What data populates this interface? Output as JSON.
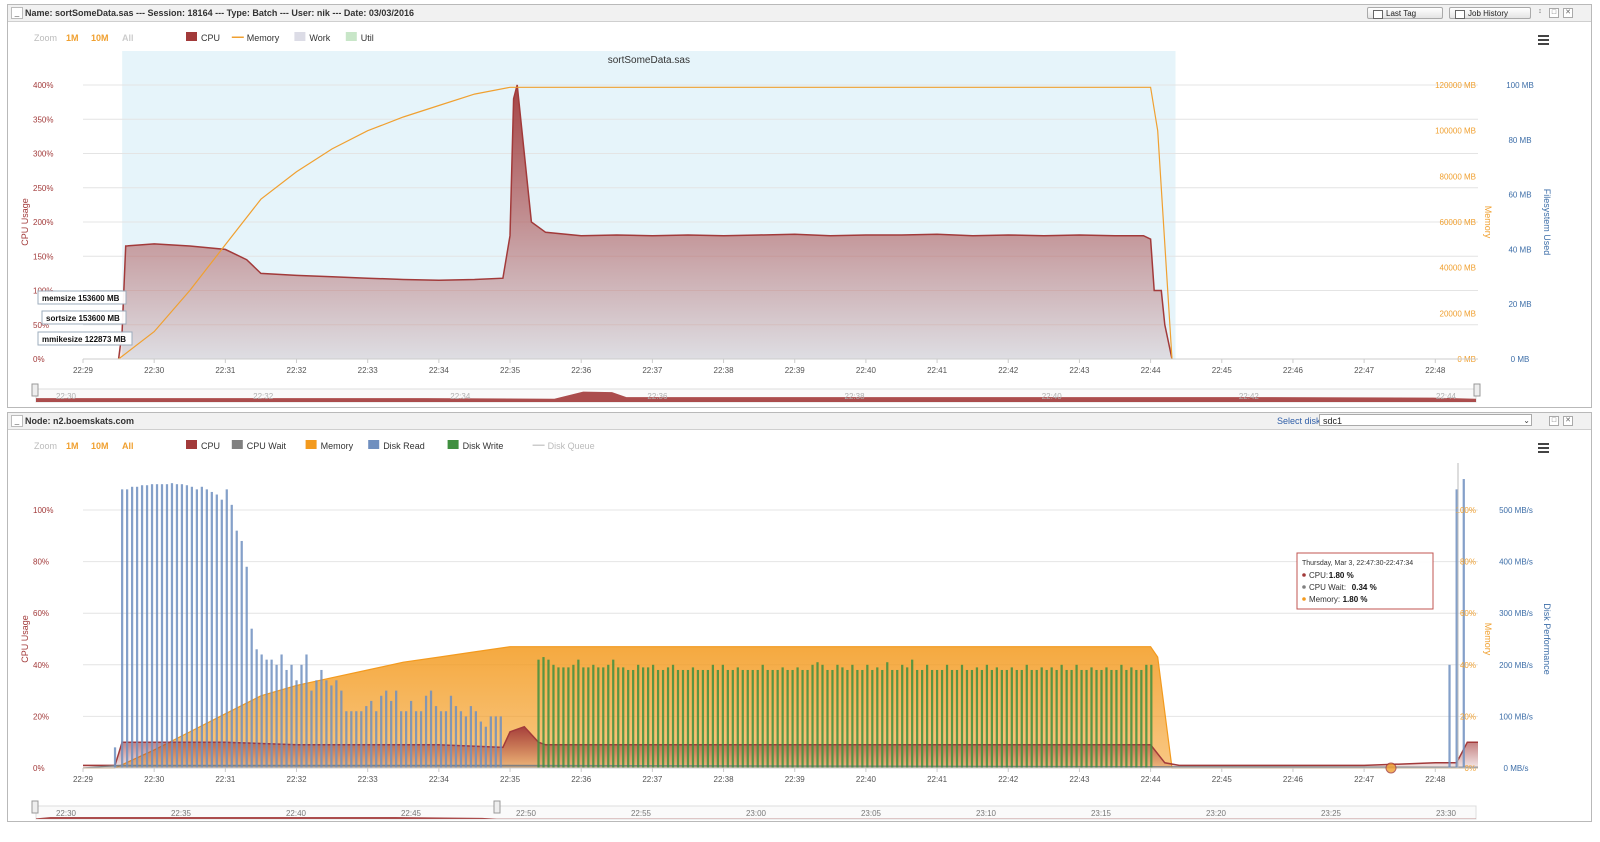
{
  "top": {
    "title": "Name: sortSomeData.sas --- Session: 18164 --- Type: Batch --- User: nik --- Date: 03/03/2016",
    "last_tag_label": "Last Tag",
    "job_history_label": "Job History",
    "zoom": {
      "label": "Zoom",
      "options": [
        "1M",
        "10M",
        "All"
      ]
    },
    "legend": [
      {
        "name": "CPU",
        "color": "#a23a3a",
        "kind": "box"
      },
      {
        "name": "Memory",
        "color": "#f0a030",
        "kind": "line"
      },
      {
        "name": "Work",
        "color": "#dcdce6",
        "kind": "box"
      },
      {
        "name": "Util",
        "color": "#c8e6c8",
        "kind": "box"
      }
    ],
    "band_label": "sortSomeData.sas",
    "annotations": [
      "memsize 153600 MB",
      "sortsize 153600 MB",
      "mmikesize 122873 MB"
    ],
    "nav_labels": [
      "22:30",
      "22:32",
      "22:34",
      "22:36",
      "22:38",
      "22:40",
      "22:42",
      "22:44"
    ]
  },
  "bottom": {
    "title": "Node: n2.boemskats.com",
    "select_disk_label": "Select disk",
    "select_disk_value": "sdc1",
    "zoom": {
      "label": "Zoom",
      "options": [
        "1M",
        "10M",
        "All"
      ]
    },
    "legend": [
      {
        "name": "CPU",
        "color": "#a23a3a",
        "kind": "box"
      },
      {
        "name": "CPU Wait",
        "color": "#808080",
        "kind": "box"
      },
      {
        "name": "Memory",
        "color": "#f39a1e",
        "kind": "box"
      },
      {
        "name": "Disk Read",
        "color": "#6f8fbf",
        "kind": "box"
      },
      {
        "name": "Disk Write",
        "color": "#3f8f3f",
        "kind": "box"
      },
      {
        "name": "Disk Queue",
        "color": "#cccccc",
        "kind": "line"
      }
    ],
    "tooltip": {
      "header": "Thursday, Mar 3, 22:47:30-22:47:34",
      "rows": [
        {
          "name": "CPU",
          "value": "1.80 %",
          "color": "#a23a3a"
        },
        {
          "name": "CPU Wait",
          "value": "0.34 %",
          "color": "#808080"
        },
        {
          "name": "Memory",
          "value": "1.80 %",
          "color": "#f39a1e"
        }
      ]
    },
    "nav_labels": [
      "22:30",
      "22:35",
      "22:40",
      "22:45",
      "22:50",
      "22:55",
      "23:00",
      "23:05",
      "23:10",
      "23:15",
      "23:20",
      "23:25",
      "23:30"
    ]
  },
  "chart_data": [
    {
      "type": "area",
      "title": "sortSomeData.sas",
      "x_ticks": [
        "22:29",
        "22:30",
        "22:31",
        "22:32",
        "22:33",
        "22:34",
        "22:35",
        "22:36",
        "22:37",
        "22:38",
        "22:39",
        "22:40",
        "22:41",
        "22:42",
        "22:43",
        "22:44",
        "22:45",
        "22:46",
        "22:47",
        "22:48"
      ],
      "x_range_minutes": [
        0,
        19.6
      ],
      "axes": {
        "left": {
          "label": "CPU Usage",
          "ticks": [
            "0%",
            "50%",
            "100%",
            "150%",
            "200%",
            "250%",
            "300%",
            "350%",
            "400%"
          ],
          "range": [
            0,
            400
          ]
        },
        "right1": {
          "label": "Memory",
          "ticks": [
            "0 MB",
            "20000 MB",
            "40000 MB",
            "60000 MB",
            "80000 MB",
            "100000 MB",
            "120000 MB"
          ],
          "range": [
            0,
            120000
          ]
        },
        "right2": {
          "label": "Filesystem Used",
          "ticks": [
            "0 MB",
            "20 MB",
            "40 MB",
            "60 MB",
            "80 MB",
            "100 MB"
          ],
          "range": [
            0,
            100
          ]
        }
      },
      "band_minutes": [
        0.55,
        15.35
      ],
      "series": [
        {
          "name": "CPU",
          "axis": "left",
          "color": "#a23a3a",
          "x": [
            0.5,
            0.55,
            0.6,
            1.0,
            1.5,
            2.0,
            2.3,
            2.5,
            3.0,
            3.5,
            4.0,
            4.5,
            5.0,
            5.5,
            5.9,
            6.0,
            6.05,
            6.1,
            6.2,
            6.3,
            6.5,
            7.0,
            7.5,
            8.0,
            8.5,
            9.0,
            9.5,
            10.0,
            10.5,
            11.0,
            11.5,
            12.0,
            12.5,
            13.0,
            13.5,
            14.0,
            14.5,
            14.9,
            15.0,
            15.05,
            15.15,
            15.2,
            15.3
          ],
          "values": [
            0,
            40,
            165,
            168,
            165,
            160,
            145,
            125,
            122,
            120,
            118,
            116,
            115,
            116,
            118,
            180,
            380,
            400,
            300,
            200,
            185,
            180,
            181,
            180,
            181,
            180,
            181,
            182,
            180,
            181,
            181,
            182,
            180,
            181,
            180,
            181,
            180,
            180,
            175,
            100,
            100,
            50,
            0
          ]
        },
        {
          "name": "Memory",
          "axis": "right1",
          "color": "#f0a030",
          "x": [
            0.5,
            1.0,
            1.5,
            2.0,
            2.5,
            3.0,
            3.5,
            4.0,
            4.5,
            5.0,
            5.5,
            6.0,
            7.0,
            8.0,
            9.0,
            10.0,
            11.0,
            12.0,
            13.0,
            14.0,
            15.0,
            15.1,
            15.3
          ],
          "values": [
            0,
            12000,
            30000,
            50000,
            70000,
            82000,
            92000,
            100000,
            106000,
            111000,
            116000,
            119000,
            119000,
            119000,
            119000,
            119000,
            119000,
            119000,
            119000,
            119000,
            119000,
            100000,
            0
          ]
        }
      ]
    },
    {
      "type": "area",
      "x_ticks": [
        "22:29",
        "22:30",
        "22:31",
        "22:32",
        "22:33",
        "22:34",
        "22:35",
        "22:36",
        "22:37",
        "22:38",
        "22:39",
        "22:40",
        "22:41",
        "22:42",
        "22:43",
        "22:44",
        "22:45",
        "22:46",
        "22:47",
        "22:48"
      ],
      "x_range_minutes": [
        0,
        19.6
      ],
      "axes": {
        "left": {
          "label": "CPU Usage",
          "ticks": [
            "0%",
            "20%",
            "40%",
            "60%",
            "80%",
            "100%"
          ],
          "range": [
            0,
            100
          ]
        },
        "right1": {
          "label": "Memory",
          "ticks": [
            "0%",
            "20%",
            "40%",
            "60%",
            "80%",
            "100%"
          ],
          "range": [
            0,
            100
          ]
        },
        "right2": {
          "label": "Disk Performance",
          "ticks": [
            "0 MB/s",
            "100 MB/s",
            "200 MB/s",
            "300 MB/s",
            "400 MB/s",
            "500 MB/s"
          ],
          "range": [
            0,
            500
          ]
        }
      },
      "series": [
        {
          "name": "Memory",
          "axis": "right1",
          "color": "#f39a1e",
          "x": [
            0,
            0.45,
            1.0,
            1.5,
            2.0,
            2.5,
            3.0,
            3.5,
            4.0,
            4.5,
            5.0,
            5.5,
            6.0,
            7.0,
            8.0,
            9.0,
            10.0,
            11.0,
            12.0,
            13.0,
            14.0,
            15.0,
            15.1,
            15.3,
            16.0,
            17.0,
            18.0,
            19.0,
            19.4,
            19.6
          ],
          "values": [
            0,
            0,
            7,
            14,
            21,
            28,
            32,
            35,
            38,
            41,
            43,
            45,
            47,
            47,
            47,
            47,
            47,
            47,
            47,
            47,
            47,
            47,
            43,
            0,
            0,
            0,
            0,
            0,
            0,
            0
          ]
        },
        {
          "name": "CPU",
          "axis": "left",
          "color": "#a23a3a",
          "x": [
            0,
            0.45,
            0.55,
            1.0,
            2.0,
            3.0,
            4.0,
            5.0,
            5.9,
            6.0,
            6.2,
            6.4,
            6.5,
            7.0,
            8.0,
            9.0,
            10.0,
            11.0,
            12.0,
            13.0,
            14.0,
            15.0,
            15.2,
            15.4,
            16.0,
            17.0,
            18.0,
            19.0,
            19.3,
            19.45,
            19.6
          ],
          "values": [
            1,
            1,
            10,
            10,
            10,
            9,
            9,
            9,
            8,
            14,
            16,
            10,
            9,
            9,
            9,
            9,
            9,
            9,
            9,
            9,
            9,
            9,
            2,
            1,
            1,
            1,
            1,
            2,
            2,
            10,
            10
          ]
        },
        {
          "name": "CPU Wait",
          "axis": "left",
          "color": "#808080",
          "x": [
            0,
            0.5,
            6.0,
            15.2,
            19.6
          ],
          "values": [
            0,
            1,
            1,
            0.5,
            0.3
          ]
        },
        {
          "name": "Disk Read",
          "axis": "right2",
          "color": "#6f8fbf",
          "bar_width_min": 0.07,
          "x": [
            0.45,
            0.55,
            0.62,
            0.69,
            0.76,
            0.83,
            0.9,
            0.97,
            1.04,
            1.11,
            1.18,
            1.25,
            1.32,
            1.39,
            1.46,
            1.53,
            1.6,
            1.67,
            1.74,
            1.81,
            1.88,
            1.95,
            2.02,
            2.09,
            2.16,
            2.23,
            2.3,
            2.37,
            2.44,
            2.51,
            2.58,
            2.65,
            2.72,
            2.79,
            2.86,
            2.93,
            3.0,
            3.07,
            3.14,
            3.21,
            3.28,
            3.35,
            3.42,
            3.49,
            3.56,
            3.63,
            3.7,
            3.77,
            3.84,
            3.91,
            3.98,
            4.05,
            4.12,
            4.19,
            4.26,
            4.33,
            4.4,
            4.47,
            4.54,
            4.61,
            4.68,
            4.75,
            4.82,
            4.89,
            4.96,
            5.03,
            5.1,
            5.17,
            5.24,
            5.31,
            5.38,
            5.45,
            5.52,
            5.59,
            5.66,
            5.73,
            5.8,
            5.87,
            19.2,
            19.3,
            19.4
          ],
          "values": [
            40,
            540,
            540,
            545,
            545,
            548,
            548,
            550,
            550,
            550,
            550,
            552,
            550,
            550,
            548,
            545,
            540,
            545,
            540,
            535,
            530,
            520,
            540,
            510,
            460,
            440,
            390,
            270,
            230,
            220,
            210,
            210,
            200,
            220,
            190,
            200,
            170,
            200,
            220,
            150,
            170,
            190,
            170,
            160,
            170,
            150,
            110,
            110,
            110,
            110,
            120,
            130,
            110,
            140,
            150,
            130,
            150,
            110,
            110,
            130,
            110,
            110,
            140,
            150,
            120,
            110,
            110,
            140,
            120,
            110,
            100,
            120,
            110,
            90,
            80,
            100,
            100,
            100,
            200,
            540,
            560
          ]
        },
        {
          "name": "Disk Write",
          "axis": "right2",
          "color": "#3f8f3f",
          "bar_width_min": 0.07,
          "x": [
            6.4,
            6.47,
            6.54,
            6.61,
            6.68,
            6.75,
            6.82,
            6.89,
            6.96,
            7.03,
            7.1,
            7.17,
            7.24,
            7.31,
            7.38,
            7.45,
            7.52,
            7.59,
            7.66,
            7.73,
            7.8,
            7.87,
            7.94,
            8.01,
            8.08,
            8.15,
            8.22,
            8.29,
            8.36,
            8.43,
            8.5,
            8.57,
            8.64,
            8.71,
            8.78,
            8.85,
            8.92,
            8.99,
            9.06,
            9.13,
            9.2,
            9.27,
            9.34,
            9.41,
            9.48,
            9.55,
            9.62,
            9.69,
            9.76,
            9.83,
            9.9,
            9.97,
            10.04,
            10.11,
            10.18,
            10.25,
            10.32,
            10.39,
            10.46,
            10.53,
            10.6,
            10.67,
            10.74,
            10.81,
            10.88,
            10.95,
            11.02,
            11.09,
            11.16,
            11.23,
            11.3,
            11.37,
            11.44,
            11.51,
            11.58,
            11.65,
            11.72,
            11.79,
            11.86,
            11.93,
            12.0,
            12.07,
            12.14,
            12.21,
            12.28,
            12.35,
            12.42,
            12.49,
            12.56,
            12.63,
            12.7,
            12.77,
            12.84,
            12.91,
            12.98,
            13.05,
            13.12,
            13.19,
            13.26,
            13.33,
            13.4,
            13.47,
            13.54,
            13.61,
            13.68,
            13.75,
            13.82,
            13.89,
            13.96,
            14.03,
            14.1,
            14.17,
            14.24,
            14.31,
            14.38,
            14.45,
            14.52,
            14.59,
            14.66,
            14.73,
            14.8,
            14.87,
            14.94,
            15.01
          ],
          "values": [
            210,
            215,
            210,
            200,
            195,
            195,
            195,
            200,
            210,
            195,
            195,
            200,
            195,
            195,
            200,
            210,
            195,
            195,
            190,
            190,
            200,
            195,
            195,
            200,
            190,
            190,
            195,
            200,
            190,
            190,
            190,
            195,
            190,
            190,
            190,
            200,
            190,
            200,
            190,
            190,
            195,
            190,
            190,
            190,
            190,
            200,
            190,
            190,
            190,
            195,
            190,
            190,
            195,
            190,
            190,
            200,
            205,
            200,
            190,
            190,
            200,
            195,
            190,
            200,
            190,
            190,
            200,
            190,
            195,
            190,
            205,
            190,
            190,
            200,
            195,
            210,
            190,
            190,
            200,
            190,
            190,
            190,
            200,
            190,
            190,
            200,
            190,
            190,
            195,
            190,
            200,
            190,
            195,
            190,
            190,
            195,
            190,
            190,
            200,
            190,
            190,
            195,
            190,
            195,
            190,
            200,
            190,
            190,
            200,
            190,
            190,
            195,
            190,
            190,
            195,
            190,
            190,
            200,
            190,
            195,
            190,
            190,
            200,
            200
          ]
        }
      ]
    }
  ]
}
